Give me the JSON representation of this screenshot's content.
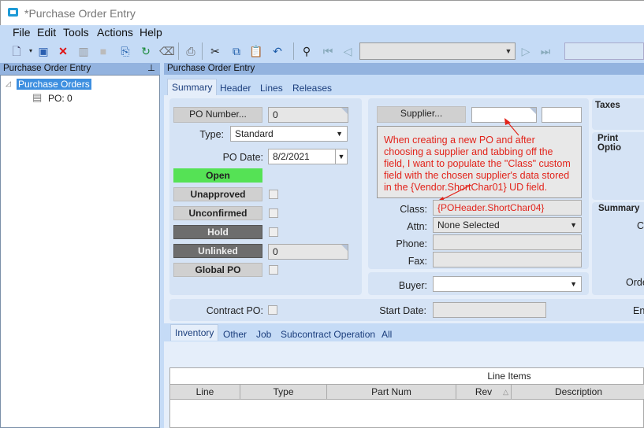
{
  "window": {
    "title": "*Purchase Order Entry"
  },
  "menu": [
    "File",
    "Edit",
    "Tools",
    "Actions",
    "Help"
  ],
  "panels": {
    "left_title": "Purchase Order Entry",
    "right_title": "Purchase Order Entry"
  },
  "tree": {
    "root": "Purchase Orders",
    "child": "PO: 0"
  },
  "tabs": [
    "Summary",
    "Header",
    "Lines",
    "Releases"
  ],
  "summary": {
    "po_number_button": "PO Number...",
    "po_number": "0",
    "type_label": "Type:",
    "type_value": "Standard",
    "po_date_label": "PO Date:",
    "po_date": "8/2/2021",
    "open": "Open",
    "unapproved": "Unapproved",
    "unconfirmed": "Unconfirmed",
    "hold": "Hold",
    "unlinked": "Unlinked",
    "unlinked_value": "0",
    "global_po": "Global PO",
    "supplier_button": "Supplier...",
    "note": "When creating a new PO and after choosing a supplier and tabbing off the field, I want to populate the \"Class\" custom field with the chosen supplier's data stored in the {Vendor.ShortChar01} UD field.",
    "class_label": "Class:",
    "class_value": "{POHeader.ShortChar04}",
    "attn_label": "Attn:",
    "attn_value": "None Selected",
    "phone_label": "Phone:",
    "fax_label": "Fax:",
    "buyer_label": "Buyer:",
    "taxes": "Taxes",
    "print_options": "Print Optio",
    "summary_title": "Summary",
    "summary_c": "C",
    "summary_order": "Orde",
    "contract_po_label": "Contract PO:",
    "start_date_label": "Start Date:",
    "end_label": "En"
  },
  "subtabs": [
    "Inventory",
    "Other",
    "Job",
    "Subcontract Operation",
    "All"
  ],
  "grid": {
    "title": "Line Items",
    "columns": [
      "Line",
      "Type",
      "Part Num",
      "Rev",
      "Description"
    ]
  },
  "colors": {
    "open_green": "#55e255",
    "hold_gray": "#6d6d6d",
    "note_red": "#e2231a"
  }
}
